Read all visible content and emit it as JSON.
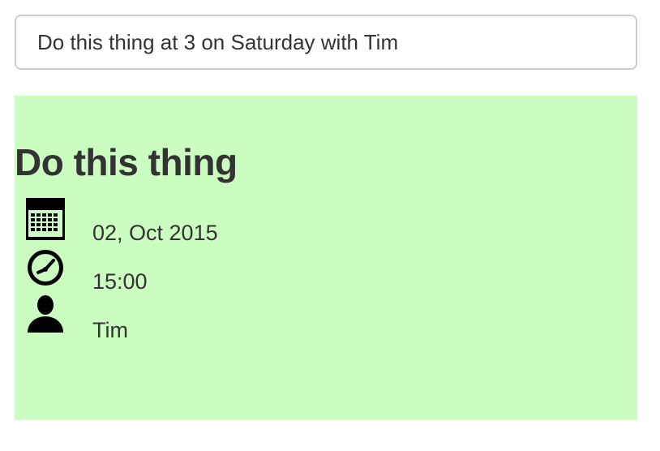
{
  "colors": {
    "card_background": "#cbfcc0",
    "text": "#333333",
    "input_border": "#cccccc"
  },
  "input": {
    "value": "Do this thing at 3 on Saturday with Tim"
  },
  "card": {
    "title": "Do this thing",
    "date": {
      "icon": "calendar-icon",
      "text": "02, Oct 2015"
    },
    "time": {
      "icon": "clock-icon",
      "text": "15:00"
    },
    "person": {
      "icon": "person-icon",
      "text": "Tim"
    }
  }
}
